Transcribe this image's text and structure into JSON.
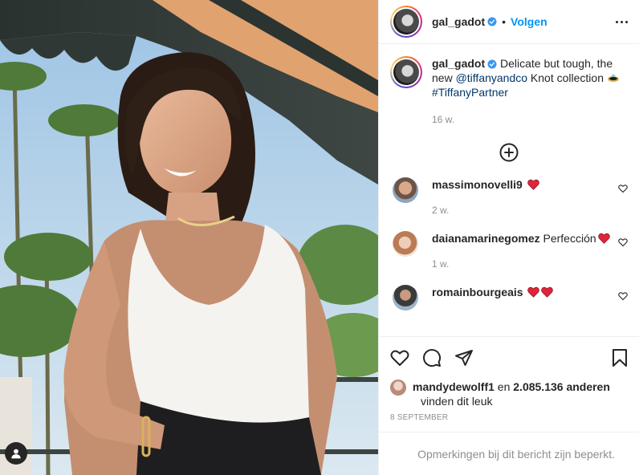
{
  "post": {
    "author": "gal_gadot",
    "follow_label": "Volgen",
    "separator": "•"
  },
  "caption": {
    "author": "gal_gadot",
    "text_part1": "Delicate but tough, the new ",
    "mention": "@tiffanyandco",
    "text_part2": " Knot collection ",
    "hashtag": "#TiffanyPartner",
    "time": "16 w."
  },
  "comments": [
    {
      "user": "massimonovelli9",
      "text": "",
      "hearts": 1,
      "time": "2 w."
    },
    {
      "user": "daianamarinegomez",
      "text": "Perfección",
      "hearts": 1,
      "time": "1 w."
    },
    {
      "user": "romainbourgeais",
      "text": "",
      "hearts": 2,
      "time": ""
    }
  ],
  "likes": {
    "user": "mandydewolff1",
    "connector": "en",
    "count": "2.085.136 anderen",
    "suffix": "vinden dit leuk"
  },
  "date": "8 SEPTEMBER",
  "footer_note": "Opmerkingen bij dit bericht zijn beperkt.",
  "colors": {
    "link": "#0095f6",
    "mention": "#00376b",
    "muted": "#8e8e8e",
    "heart": "#e0243b"
  },
  "icons": [
    "more-icon",
    "plus-circle-icon",
    "heart-outline-icon",
    "comment-icon",
    "share-icon",
    "bookmark-icon",
    "verified-icon",
    "ring-emoji",
    "heart-emoji",
    "user-tag-icon"
  ]
}
